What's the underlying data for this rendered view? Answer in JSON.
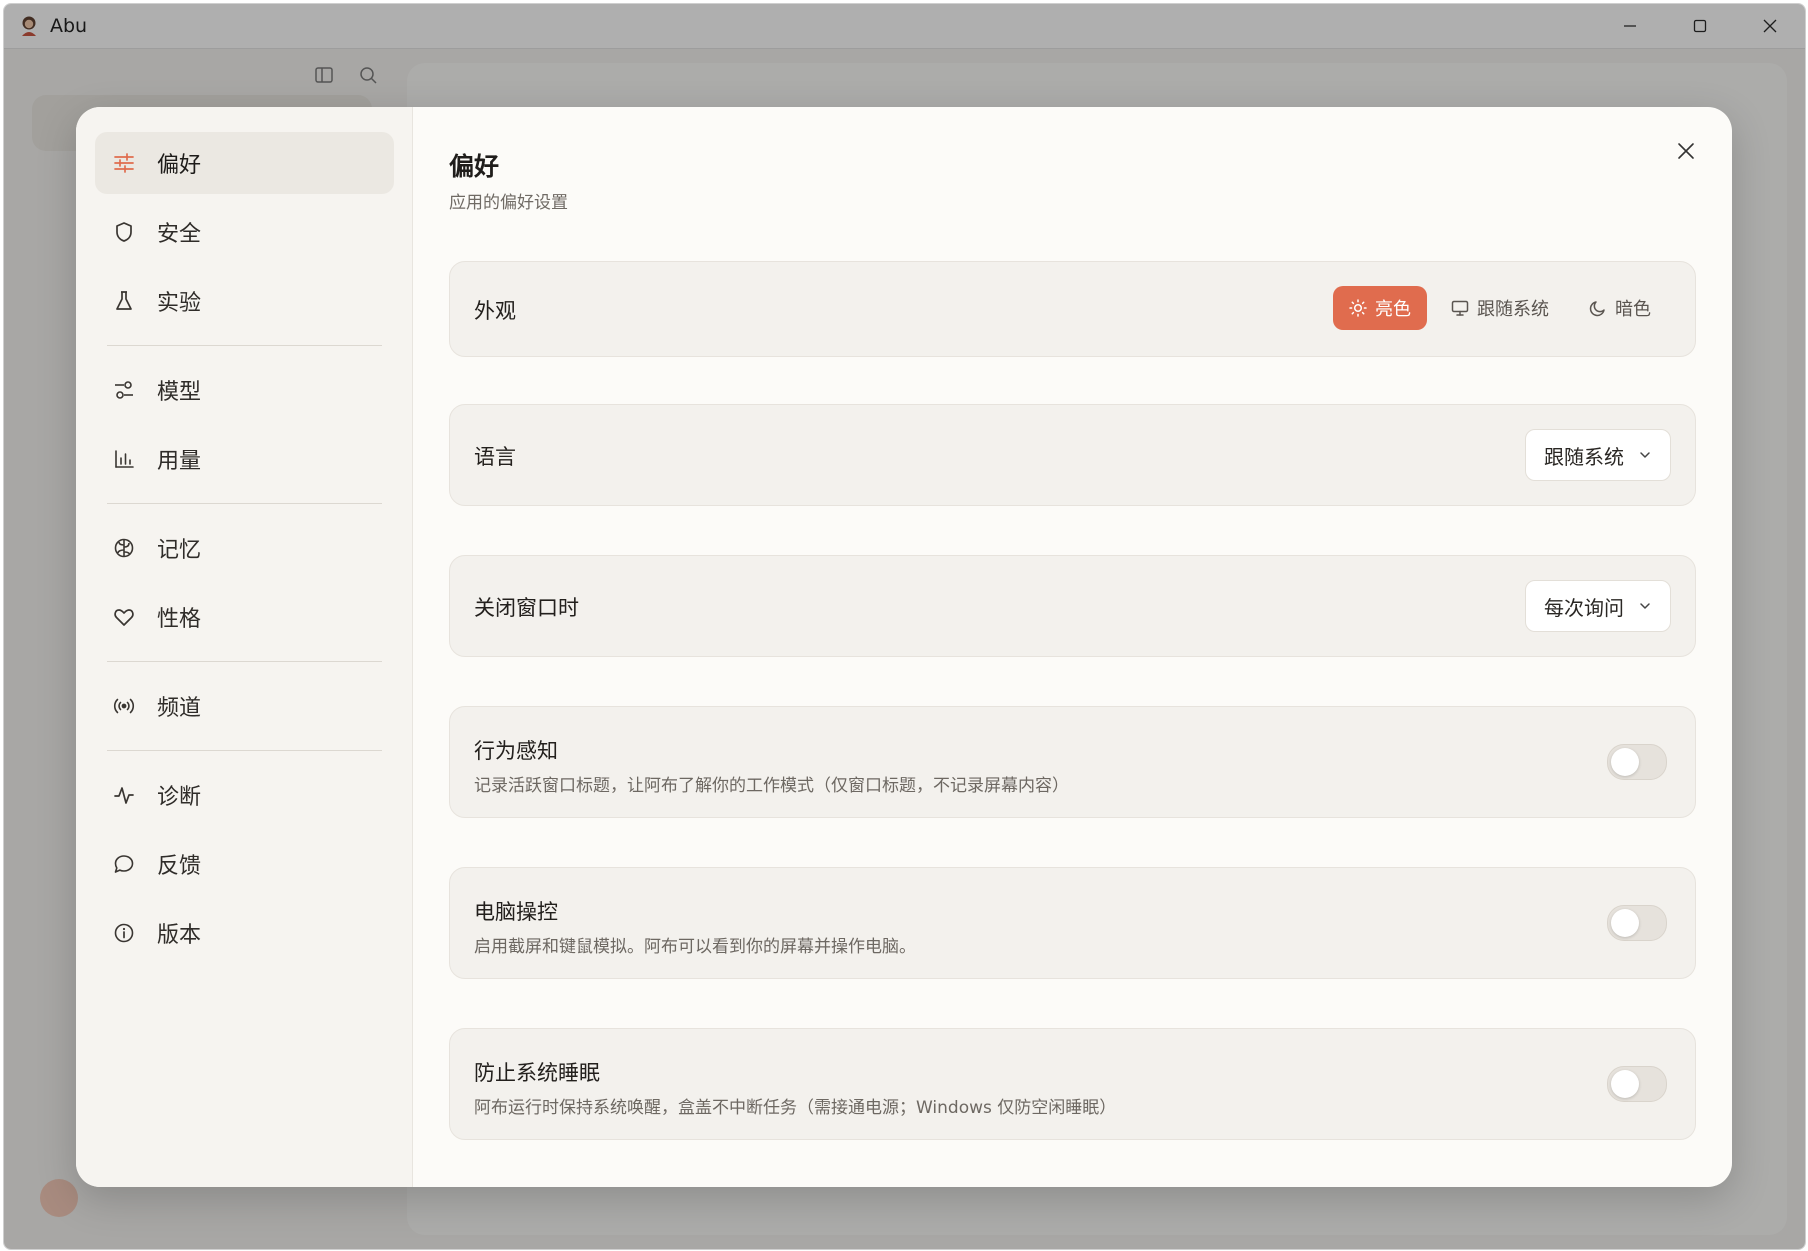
{
  "window": {
    "title": "Abu"
  },
  "nav": {
    "groups": [
      [
        {
          "label": "偏好",
          "icon": "sliders-icon",
          "active": true
        },
        {
          "label": "安全",
          "icon": "shield-icon"
        },
        {
          "label": "实验",
          "icon": "flask-icon"
        }
      ],
      [
        {
          "label": "模型",
          "icon": "model-settings-icon"
        },
        {
          "label": "用量",
          "icon": "bar-chart-icon"
        }
      ],
      [
        {
          "label": "记忆",
          "icon": "brain-icon"
        },
        {
          "label": "性格",
          "icon": "heart-icon"
        }
      ],
      [
        {
          "label": "频道",
          "icon": "broadcast-icon"
        }
      ],
      [
        {
          "label": "诊断",
          "icon": "activity-icon"
        },
        {
          "label": "反馈",
          "icon": "chat-bubble-icon"
        },
        {
          "label": "版本",
          "icon": "info-icon"
        }
      ]
    ]
  },
  "page": {
    "title": "偏好",
    "subtitle": "应用的偏好设置"
  },
  "appearance": {
    "label": "外观",
    "options": [
      {
        "label": "亮色",
        "icon": "sun-icon",
        "selected": true
      },
      {
        "label": "跟随系统",
        "icon": "monitor-icon",
        "selected": false
      },
      {
        "label": "暗色",
        "icon": "moon-icon",
        "selected": false
      }
    ]
  },
  "language": {
    "label": "语言",
    "value": "跟随系统"
  },
  "close_window": {
    "label": "关闭窗口时",
    "value": "每次询问"
  },
  "behavior_awareness": {
    "label": "行为感知",
    "description": "记录活跃窗口标题，让阿布了解你的工作模式（仅窗口标题，不记录屏幕内容）",
    "enabled": false
  },
  "computer_control": {
    "label": "电脑操控",
    "description": "启用截屏和键鼠模拟。阿布可以看到你的屏幕并操作电脑。",
    "enabled": false
  },
  "prevent_sleep": {
    "label": "防止系统睡眠",
    "description": "阿布运行时保持系统唤醒，盒盖不中断任务（需接通电源；Windows 仅防空闲睡眠）",
    "enabled": false
  },
  "colors": {
    "accent": "#e06c4e"
  }
}
